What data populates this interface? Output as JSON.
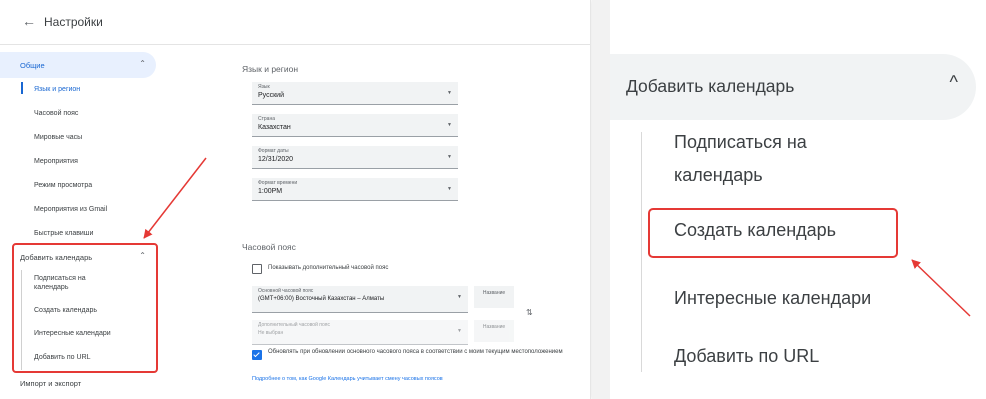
{
  "left_panel": {
    "back_arrow": "←",
    "title": "Настройки",
    "sidebar": {
      "general_label": "Общие",
      "general_items": [
        "Язык и регион",
        "Часовой пояс",
        "Мировые часы",
        "Мероприятия",
        "Режим просмотра",
        "Мероприятия из Gmail",
        "Быстрые клавиши"
      ],
      "add_calendar_label": "Добавить календарь",
      "add_calendar_items": [
        "Подписаться на календарь",
        "Создать календарь",
        "Интересные календари",
        "Добавить по URL"
      ],
      "import_export_label": "Импорт и экспорт"
    },
    "content": {
      "lang_section_title": "Язык и регион",
      "fields": [
        {
          "label": "Язык",
          "value": "Русский"
        },
        {
          "label": "Страна",
          "value": "Казахстан"
        },
        {
          "label": "Формат даты",
          "value": "12/31/2020"
        },
        {
          "label": "Формат времени",
          "value": "1:00PM"
        }
      ],
      "tz_section_title": "Часовой пояс",
      "show_secondary_tz": "Показывать дополнительный часовой пояс",
      "primary_tz_label": "Основной часовой пояс",
      "primary_tz_value": "(GMT+06:00) Восточный Казахстан – Алматы",
      "primary_tz_name": "Название",
      "secondary_tz_label": "Дополнительный часовой пояс",
      "secondary_tz_value": "Не выбран",
      "secondary_tz_name": "Название",
      "update_tz_text": "Обновлять при обновлении основного часового пояса в соответствии с моим текущим местоположением",
      "help_link": "Подробнее о том, как Google Календарь учитывает смену часовых поясов"
    }
  },
  "right_panel": {
    "group_label": "Добавить календарь",
    "chevron": "^",
    "items": [
      "Подписаться на календарь",
      "Создать календарь",
      "Интересные календари",
      "Добавить по URL"
    ]
  },
  "colors": {
    "highlight_red": "#e53935",
    "active_blue": "#1967d2",
    "group_bg": "#f1f3f4"
  }
}
